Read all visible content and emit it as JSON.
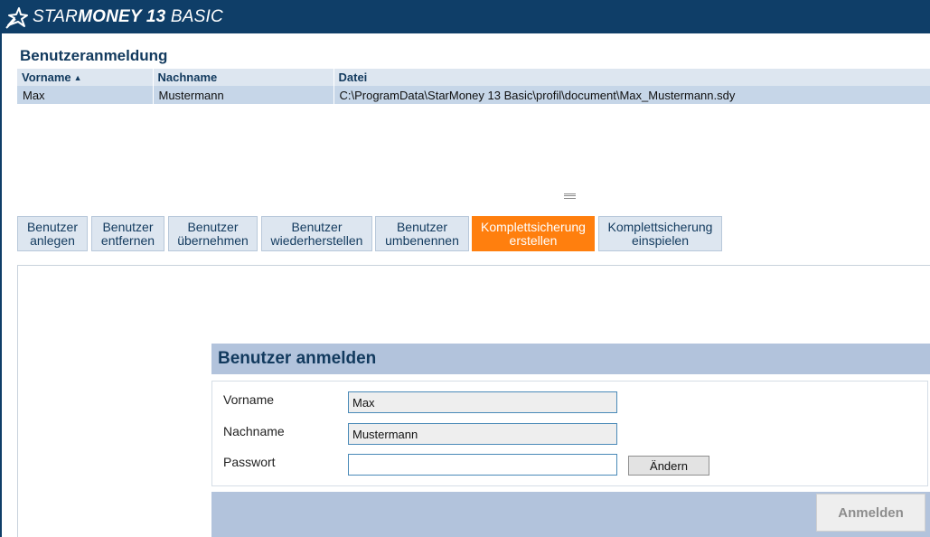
{
  "app": {
    "title_prefix": "STAR",
    "title_bold": "MONEY 13",
    "title_suffix": " BASIC",
    "logo_icon": "starmoney-star-icon"
  },
  "page": {
    "title": "Benutzeranmeldung"
  },
  "table": {
    "columns": [
      "Vorname",
      "Nachname",
      "Datei"
    ],
    "sort_column": "Vorname",
    "sort_direction": "ascending",
    "rows": [
      {
        "vorname": "Max",
        "nachname": "Mustermann",
        "datei": "C:\\ProgramData\\StarMoney 13 Basic\\profil\\document\\Max_Mustermann.sdy",
        "selected": true
      }
    ]
  },
  "toolbar": {
    "buttons": [
      {
        "label": "Benutzer\nanlegen"
      },
      {
        "label": "Benutzer\nentfernen"
      },
      {
        "label": "Benutzer\nübernehmen"
      },
      {
        "label": "Benutzer\nwiederherstellen"
      },
      {
        "label": "Benutzer\numbenennen"
      },
      {
        "label": "Komplettsicherung\nerstellen",
        "highlighted": true
      },
      {
        "label": "Komplettsicherung\neinspielen"
      }
    ]
  },
  "login": {
    "title": "Benutzer anmelden",
    "vorname_label": "Vorname",
    "vorname_value": "Max",
    "nachname_label": "Nachname",
    "nachname_value": "Mustermann",
    "passwort_label": "Passwort",
    "passwort_value": "",
    "aendern_label": "Ändern",
    "submit_label": "Anmelden",
    "submit_enabled": false
  },
  "colors": {
    "titlebar": "#0f3e68",
    "accent_orange": "#ff7f0e",
    "header_blue": "#b2c3dc",
    "selected_row": "#c6d6e8",
    "text_dark_blue": "#123a5e"
  }
}
